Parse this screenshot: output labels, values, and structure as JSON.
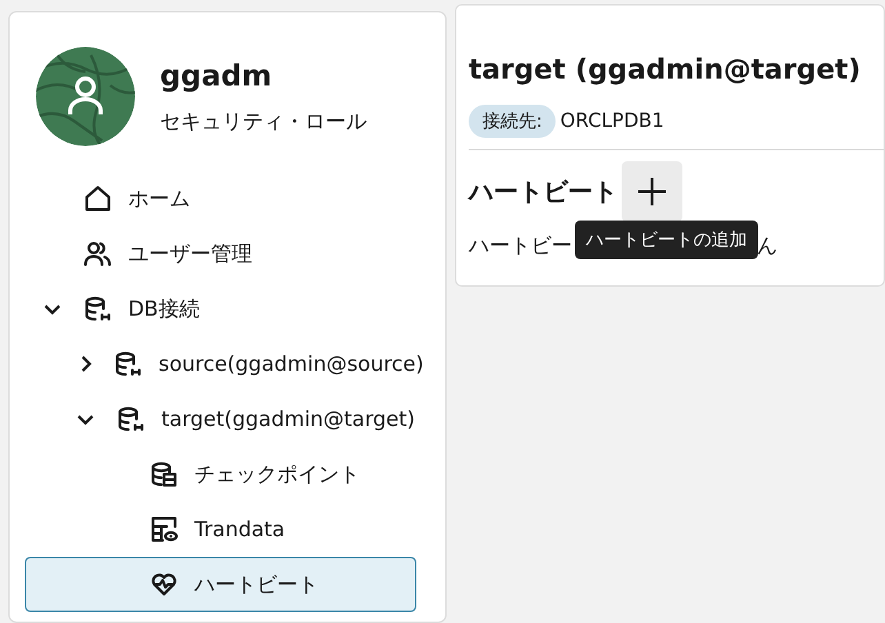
{
  "user": {
    "name": "ggadm",
    "role": "セキュリティ・ロール"
  },
  "nav": [
    {
      "kind": "home",
      "label": "ホーム",
      "selected": false
    },
    {
      "kind": "users",
      "label": "ユーザー管理",
      "selected": false
    },
    {
      "kind": "connections",
      "label": "DB接続",
      "selected": false,
      "expanded": true,
      "children": [
        {
          "kind": "connection",
          "label": "source(ggadmin@source)",
          "selected": false,
          "expanded": false
        },
        {
          "kind": "connection",
          "label": "target(ggadmin@target)",
          "selected": false,
          "expanded": true,
          "children": [
            {
              "kind": "checkpoint",
              "label": "チェックポイント",
              "selected": false
            },
            {
              "kind": "trandata",
              "label": "Trandata",
              "selected": false
            },
            {
              "kind": "heartbeat",
              "label": "ハートビート",
              "selected": true
            }
          ]
        }
      ]
    }
  ],
  "detail": {
    "title": "target (ggadmin@target)",
    "badge": "接続先:",
    "connection": "ORCLPDB1",
    "section": "ハートビート",
    "message_start": "ハートビー",
    "message_end": "ん",
    "tooltip": "ハートビートの追加"
  }
}
